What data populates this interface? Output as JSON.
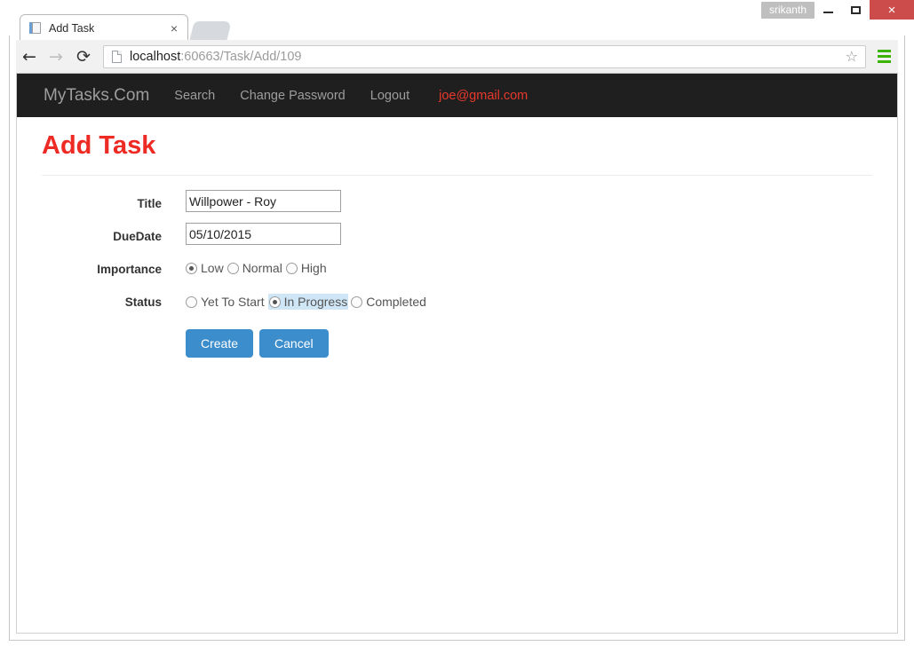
{
  "window": {
    "user_badge": "srikanth",
    "minimize_label": "–",
    "maximize_label": "",
    "close_label": "×"
  },
  "browser": {
    "tab": {
      "title": "Add Task",
      "close_label": "×"
    },
    "back_label": "←",
    "forward_label": "→",
    "reload_label": "⟳",
    "url_host": "localhost",
    "url_path": ":60663/Task/Add/109",
    "star_label": "☆"
  },
  "navbar": {
    "brand": "MyTasks.Com",
    "links": [
      {
        "label": "Search"
      },
      {
        "label": "Change Password"
      },
      {
        "label": "Logout"
      }
    ],
    "user_email": "joe@gmail.com",
    "email_color": "#e8392c"
  },
  "page": {
    "title": "Add Task",
    "title_color": "#ee2a24"
  },
  "form": {
    "title_label": "Title",
    "title_value": "Willpower - Roy",
    "duedate_label": "DueDate",
    "duedate_value": "05/10/2015",
    "importance_label": "Importance",
    "importance_options": [
      {
        "label": "Low",
        "checked": true
      },
      {
        "label": "Normal",
        "checked": false
      },
      {
        "label": "High",
        "checked": false
      }
    ],
    "status_label": "Status",
    "status_options": [
      {
        "label": "Yet To Start",
        "checked": false,
        "focused": false
      },
      {
        "label": "In Progress",
        "checked": true,
        "focused": true
      },
      {
        "label": "Completed",
        "checked": false,
        "focused": false
      }
    ],
    "create_label": "Create",
    "cancel_label": "Cancel",
    "button_color": "#3c8dcc"
  }
}
